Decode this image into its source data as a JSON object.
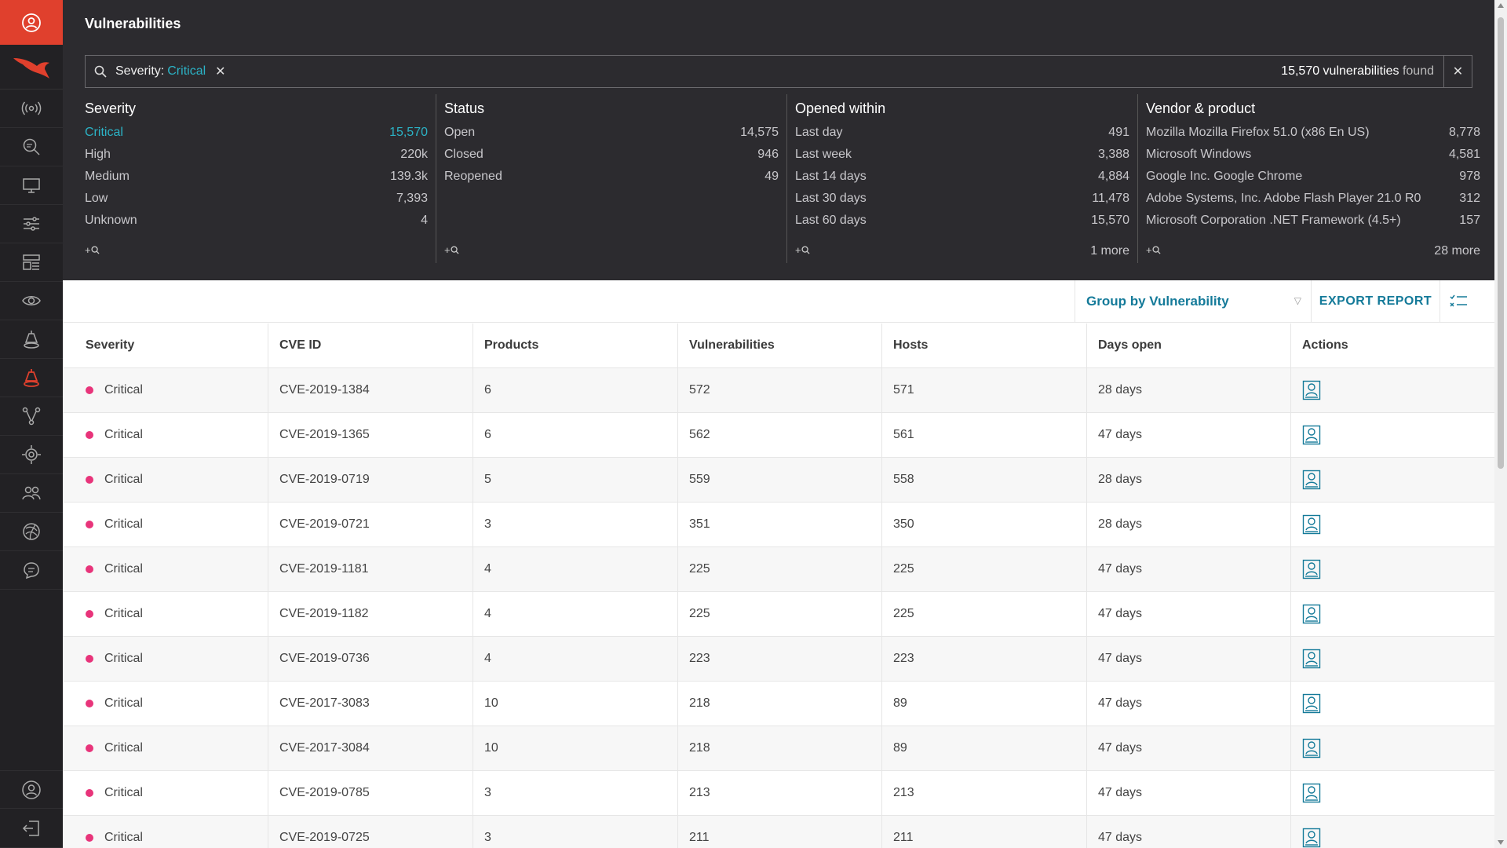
{
  "colors": {
    "accent": "#147a99",
    "brand": "#e0402d",
    "critical_dot": "#e8347a",
    "active_filter": "#2bb3c6",
    "header_bg": "#2c2b2f",
    "nav_bg": "#222124"
  },
  "nav": {
    "items": [
      "user-icon",
      "falcon-logo",
      "radar-icon",
      "search-icon",
      "monitor-icon",
      "sliders-icon",
      "dashboard-icon",
      "eye-icon",
      "spotlight-icon",
      "spotlight-active-icon",
      "graph-icon",
      "settings-target-icon",
      "users-icon",
      "intelligence-icon",
      "support-icon",
      "account-icon",
      "logout-icon"
    ]
  },
  "header": {
    "title": "Vulnerabilities",
    "filter": {
      "key": "Severity:",
      "value": "Critical",
      "count": "15,570 vulnerabilities",
      "found": "found"
    }
  },
  "facets": [
    {
      "title": "Severity",
      "rows": [
        {
          "label": "Critical",
          "value": "15,570"
        },
        {
          "label": "High",
          "value": "220k"
        },
        {
          "label": "Medium",
          "value": "139.3k"
        },
        {
          "label": "Low",
          "value": "7,393"
        },
        {
          "label": "Unknown",
          "value": "4"
        }
      ],
      "add": "+🔍",
      "more": ""
    },
    {
      "title": "Status",
      "rows": [
        {
          "label": "Open",
          "value": "14,575"
        },
        {
          "label": "Closed",
          "value": "946"
        },
        {
          "label": "Reopened",
          "value": "49"
        }
      ],
      "add": "+🔍",
      "more": ""
    },
    {
      "title": "Opened within",
      "rows": [
        {
          "label": "Last day",
          "value": "491"
        },
        {
          "label": "Last week",
          "value": "3,388"
        },
        {
          "label": "Last 14 days",
          "value": "4,884"
        },
        {
          "label": "Last 30 days",
          "value": "11,478"
        },
        {
          "label": "Last 60 days",
          "value": "15,570"
        }
      ],
      "add": "+🔍",
      "more": "1 more"
    },
    {
      "title": "Vendor & product",
      "rows": [
        {
          "label": "Mozilla Mozilla Firefox 51.0 (x86 En US)",
          "value": "8,778"
        },
        {
          "label": "Microsoft Windows",
          "value": "4,581"
        },
        {
          "label": "Google Inc. Google Chrome",
          "value": "978"
        },
        {
          "label": "Adobe Systems, Inc. Adobe Flash Player 21.0 R0",
          "value": "312"
        },
        {
          "label": "Microsoft Corporation .NET Framework (4.5+)",
          "value": "157"
        }
      ],
      "add": "+🔍",
      "more": "28 more"
    }
  ],
  "toolbar": {
    "group_by": "Group by Vulnerability",
    "export": "EXPORT REPORT"
  },
  "table": {
    "columns": [
      "Severity",
      "CVE ID",
      "Products",
      "Vulnerabilities",
      "Hosts",
      "Days open",
      "Actions"
    ],
    "rows": [
      {
        "severity": "Critical",
        "cve": "CVE-2019-1384",
        "products": "6",
        "vulns": "572",
        "hosts": "571",
        "days": "28 days"
      },
      {
        "severity": "Critical",
        "cve": "CVE-2019-1365",
        "products": "6",
        "vulns": "562",
        "hosts": "561",
        "days": "47 days"
      },
      {
        "severity": "Critical",
        "cve": "CVE-2019-0719",
        "products": "5",
        "vulns": "559",
        "hosts": "558",
        "days": "28 days"
      },
      {
        "severity": "Critical",
        "cve": "CVE-2019-0721",
        "products": "3",
        "vulns": "351",
        "hosts": "350",
        "days": "28 days"
      },
      {
        "severity": "Critical",
        "cve": "CVE-2019-1181",
        "products": "4",
        "vulns": "225",
        "hosts": "225",
        "days": "47 days"
      },
      {
        "severity": "Critical",
        "cve": "CVE-2019-1182",
        "products": "4",
        "vulns": "225",
        "hosts": "225",
        "days": "47 days"
      },
      {
        "severity": "Critical",
        "cve": "CVE-2019-0736",
        "products": "4",
        "vulns": "223",
        "hosts": "223",
        "days": "47 days"
      },
      {
        "severity": "Critical",
        "cve": "CVE-2017-3083",
        "products": "10",
        "vulns": "218",
        "hosts": "89",
        "days": "47 days"
      },
      {
        "severity": "Critical",
        "cve": "CVE-2017-3084",
        "products": "10",
        "vulns": "218",
        "hosts": "89",
        "days": "47 days"
      },
      {
        "severity": "Critical",
        "cve": "CVE-2019-0785",
        "products": "3",
        "vulns": "213",
        "hosts": "213",
        "days": "47 days"
      },
      {
        "severity": "Critical",
        "cve": "CVE-2019-0725",
        "products": "3",
        "vulns": "211",
        "hosts": "211",
        "days": "47 days"
      }
    ]
  }
}
